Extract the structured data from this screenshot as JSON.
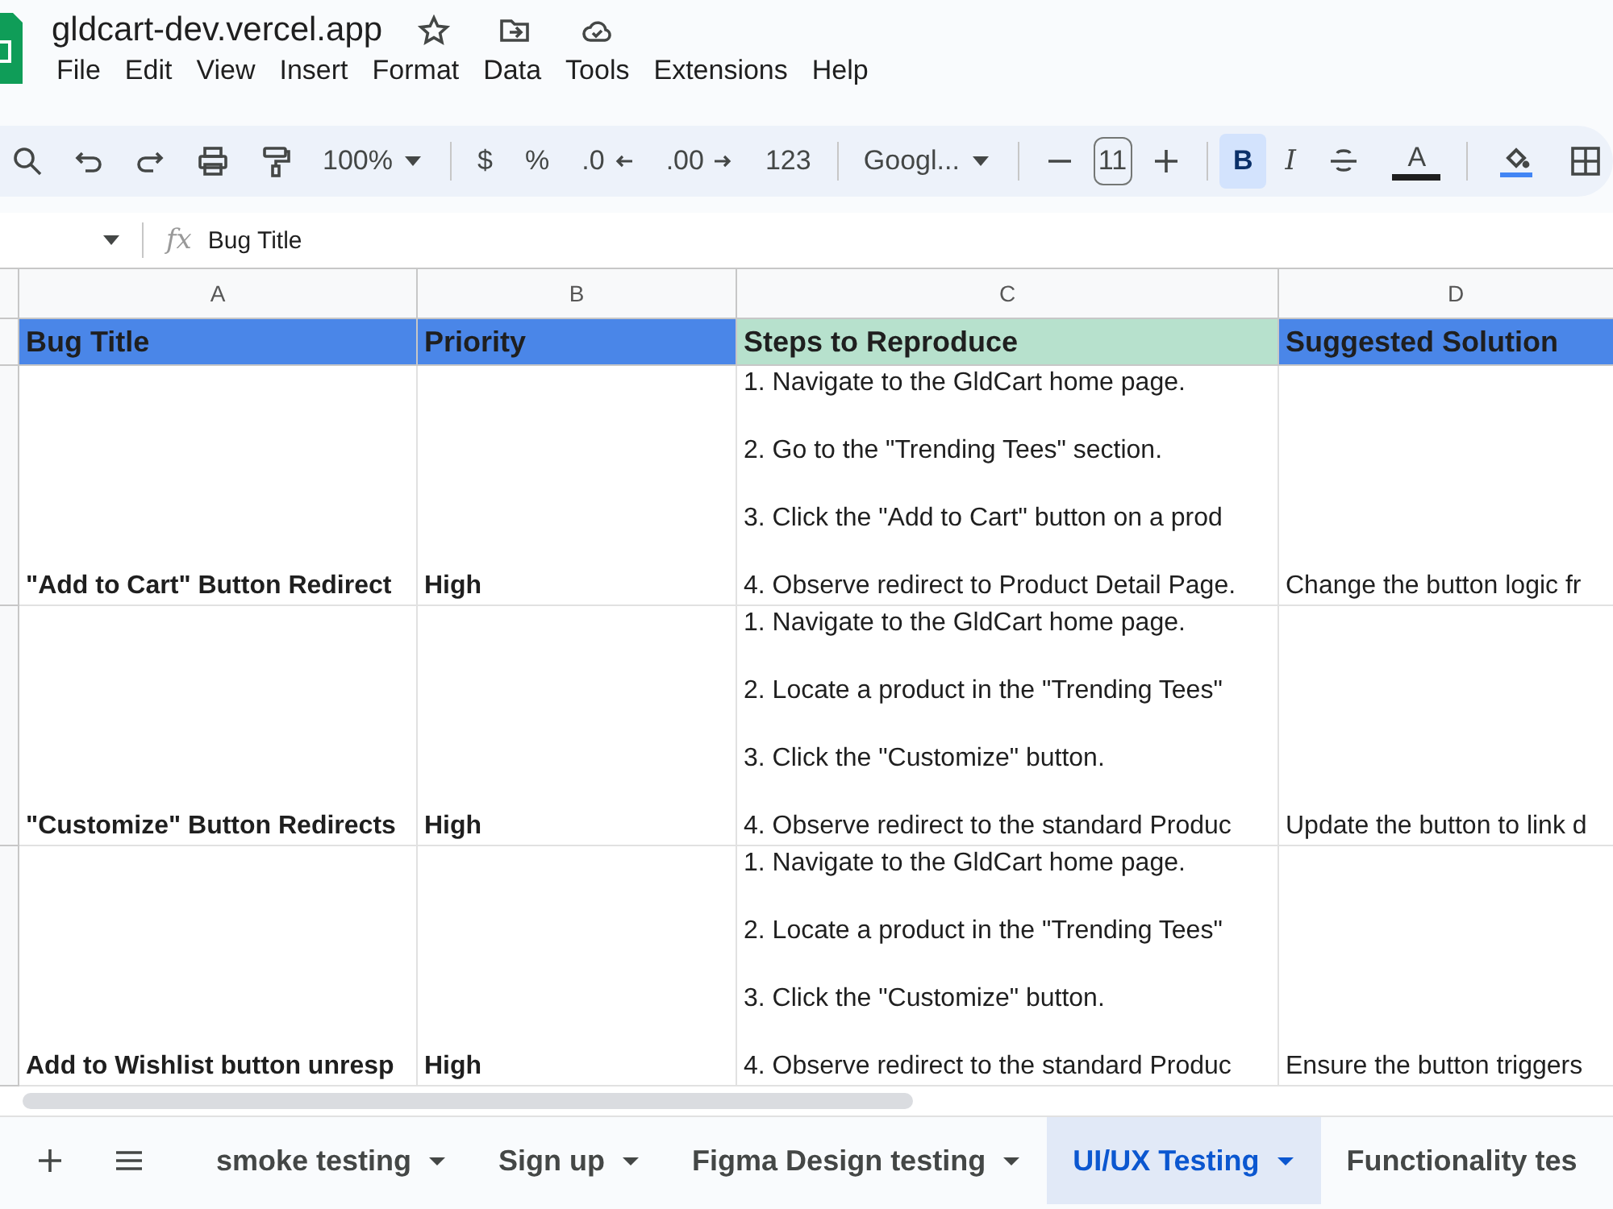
{
  "document": {
    "title": "gldcart-dev.vercel.app"
  },
  "menu": [
    "File",
    "Edit",
    "View",
    "Insert",
    "Format",
    "Data",
    "Tools",
    "Extensions",
    "Help"
  ],
  "toolbar": [
    {
      "kind": "search"
    },
    {
      "kind": "undo"
    },
    {
      "kind": "redo"
    },
    {
      "kind": "print"
    },
    {
      "kind": "paint"
    },
    {
      "kind": "dropdown",
      "label": "100%"
    },
    {
      "kind": "sep"
    },
    {
      "kind": "text",
      "label": "$"
    },
    {
      "kind": "text",
      "label": "%"
    },
    {
      "kind": "decdown",
      "label": ".0"
    },
    {
      "kind": "decup",
      "label": ".00"
    },
    {
      "kind": "text",
      "label": "123"
    },
    {
      "kind": "sep"
    },
    {
      "kind": "dropdown",
      "label": "Googl..."
    },
    {
      "kind": "sep"
    },
    {
      "kind": "minus"
    },
    {
      "kind": "field",
      "label": "11"
    },
    {
      "kind": "plus"
    },
    {
      "kind": "sep"
    },
    {
      "kind": "bold",
      "label": "B",
      "selected": true
    },
    {
      "kind": "italic",
      "label": "I",
      "selected": false
    },
    {
      "kind": "strike"
    },
    {
      "kind": "textcolor",
      "label": "A"
    },
    {
      "kind": "sep"
    },
    {
      "kind": "fill"
    },
    {
      "kind": "borders"
    }
  ],
  "formula_bar": {
    "icon": "fx",
    "value": "Bug Title"
  },
  "columns": [
    "A",
    "B",
    "C",
    "D"
  ],
  "header_row": [
    {
      "text": "Bug Title",
      "color": "#4a86e8"
    },
    {
      "text": "Priority",
      "color": "#4a86e8"
    },
    {
      "text": "Steps to Reproduce",
      "color": "#b7e1cd"
    },
    {
      "text": "Suggested Solution",
      "color": "#4a86e8"
    }
  ],
  "rows": [
    {
      "bug_title": "\"Add to Cart\" Button Redirect",
      "priority": "High",
      "steps": [
        "1. Navigate to the GldCart home page.",
        "2. Go to the \"Trending Tees\" section.",
        "3. Click the \"Add to Cart\" button on a prod",
        "4. Observe redirect to Product Detail Page."
      ],
      "solution": "Change the button logic fr"
    },
    {
      "bug_title": "\"Customize\" Button Redirects",
      "priority": "High",
      "steps": [
        "1. Navigate to the GldCart home page.",
        "2. Locate a product in the \"Trending Tees\"",
        "3. Click the \"Customize\" button.",
        "4. Observe redirect to the standard Produc"
      ],
      "solution": "Update the button to link d"
    },
    {
      "bug_title": "Add to Wishlist button unresp",
      "priority": "High",
      "steps": [
        "1. Navigate to the GldCart home page.",
        "2. Locate a product in the \"Trending Tees\"",
        "3. Click the \"Customize\" button.",
        "4. Observe redirect to the standard Produc"
      ],
      "solution": "Ensure the button triggers"
    }
  ],
  "sheet_tabs": [
    {
      "label": "smoke testing",
      "selected": false
    },
    {
      "label": "Sign up",
      "selected": false
    },
    {
      "label": "Figma Design testing",
      "selected": false
    },
    {
      "label": "UI/UX Testing",
      "selected": true
    },
    {
      "label": "Functionality tes",
      "selected": false
    }
  ]
}
